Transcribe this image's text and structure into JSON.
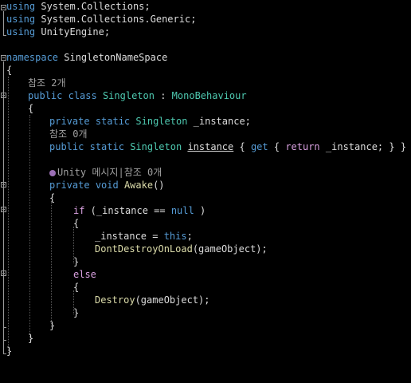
{
  "editor": {
    "lines": {
      "l1": {
        "kw": "using",
        "rest": " System.Collections;"
      },
      "l2": {
        "kw": "using",
        "rest": " System.Collections.Generic;"
      },
      "l3": {
        "kw": "using",
        "rest": " UnityEngine;"
      },
      "l5": {
        "kw": "namespace",
        "rest": " SingletonNameSpace"
      },
      "l6": {
        "text": "{"
      },
      "l7": {
        "lens": "참조 2개"
      },
      "l8": {
        "kw1": "public",
        "kw2": "class",
        "type": "Singleton",
        "sep": " : ",
        "base": "MonoBehaviour"
      },
      "l9": {
        "text": "{"
      },
      "l10": {
        "kw1": "private",
        "kw2": "static",
        "type": "Singleton",
        "field": " _instance;"
      },
      "l11": {
        "lens": "참조 0개"
      },
      "l12": {
        "kw1": "public",
        "kw2": "static",
        "type": "Singleton",
        "prop": "instance",
        "open": " { ",
        "get": "get",
        "brace": " { ",
        "ret": "return",
        "tail": " _instance; } }"
      },
      "l14": {
        "lens": "Unity 메시지|참조 0개"
      },
      "l15": {
        "kw1": "private",
        "kw2": "void",
        "method": "Awake",
        "paren": "()"
      },
      "l16": {
        "text": "{"
      },
      "l17": {
        "ctrl": "if",
        "pre": " (_instance == ",
        "kw": "null",
        "post": " )"
      },
      "l18": {
        "text": "{"
      },
      "l19": {
        "pre": "_instance = ",
        "kw": "this",
        "post": ";"
      },
      "l20": {
        "method": "DontDestroyOnLoad",
        "args": "(gameObject);"
      },
      "l21": {
        "text": "}"
      },
      "l22": {
        "ctrl": "else"
      },
      "l23": {
        "text": "{"
      },
      "l24": {
        "method": "Destroy",
        "args": "(gameObject);"
      },
      "l25": {
        "text": "}"
      },
      "l26": {
        "text": "}"
      },
      "l27": {
        "text": "}"
      },
      "l28": {
        "text": "}"
      }
    },
    "icons": {
      "unity_message": "unity-message-icon"
    },
    "colors": {
      "background": "#000000",
      "keyword": "#569cd6",
      "type": "#4ec9b0",
      "method": "#dcdcaa",
      "control": "#d8a0df",
      "text": "#dcdcdc",
      "codelens": "#a0a0a0"
    }
  }
}
